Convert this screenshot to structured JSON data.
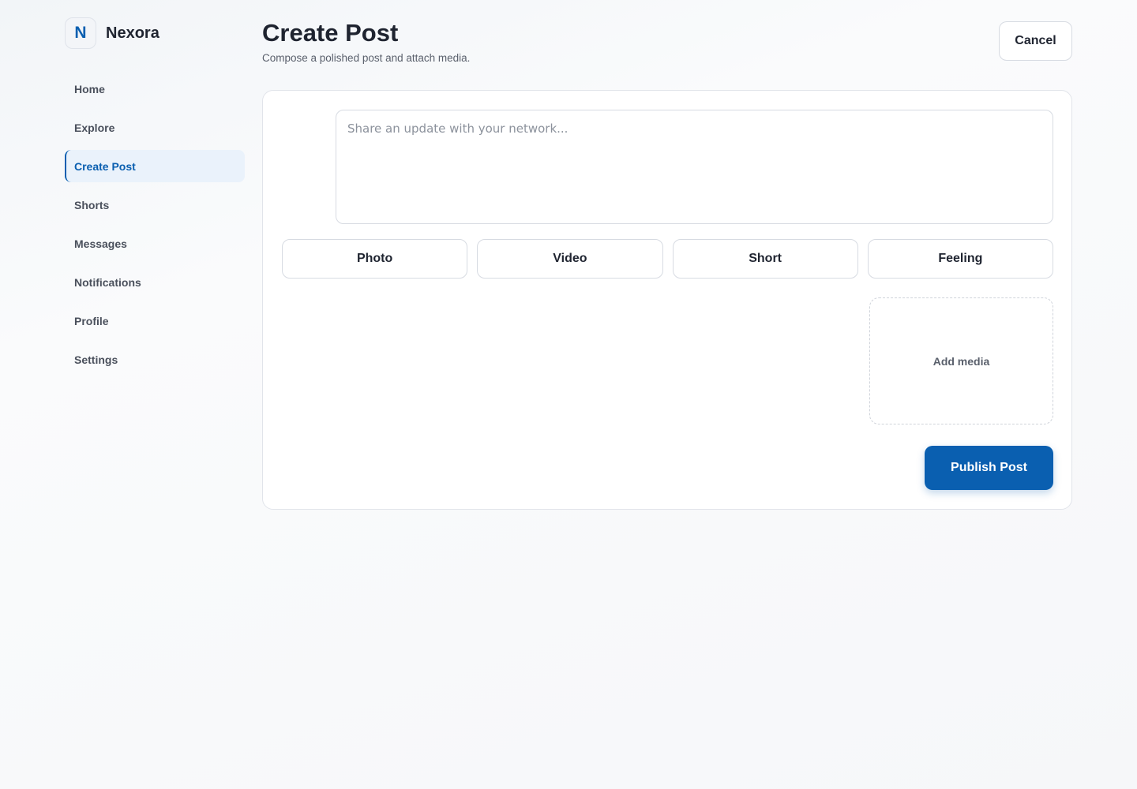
{
  "brand": {
    "logo_letter": "N",
    "name": "Nexora"
  },
  "sidebar": {
    "items": [
      {
        "label": "Home",
        "active": false
      },
      {
        "label": "Explore",
        "active": false
      },
      {
        "label": "Create Post",
        "active": true
      },
      {
        "label": "Shorts",
        "active": false
      },
      {
        "label": "Messages",
        "active": false
      },
      {
        "label": "Notifications",
        "active": false
      },
      {
        "label": "Profile",
        "active": false
      },
      {
        "label": "Settings",
        "active": false
      }
    ]
  },
  "header": {
    "title": "Create Post",
    "subtitle": "Compose a polished post and attach media.",
    "cancel_label": "Cancel"
  },
  "composer": {
    "value": "",
    "placeholder": "Share an update with your network..."
  },
  "post_types": [
    {
      "label": "Photo"
    },
    {
      "label": "Video"
    },
    {
      "label": "Short"
    },
    {
      "label": "Feeling"
    }
  ],
  "media": {
    "add_label": "Add media"
  },
  "actions": {
    "publish_label": "Publish Post"
  },
  "colors": {
    "accent": "#0a5fb0",
    "active_bg": "#eaf2fb",
    "text": "#1f2430",
    "muted": "#5a606c",
    "border": "#d7dbe2"
  }
}
